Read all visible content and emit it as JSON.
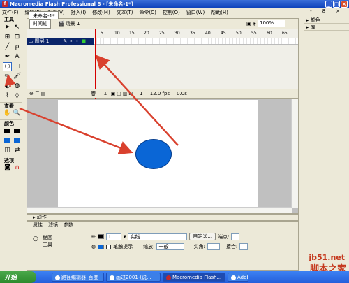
{
  "window": {
    "title": "Macromedia Flash Professional 8 - [未命名-1*]",
    "min": "_",
    "max": "□",
    "close": "×"
  },
  "menu": {
    "items": [
      "文件(F)",
      "编辑(E)",
      "视图(V)",
      "插入(I)",
      "修改(M)",
      "文本(T)",
      "命令(C)",
      "控制(O)",
      "窗口(W)",
      "帮助(H)"
    ],
    "right": [
      "-",
      "8",
      "×"
    ]
  },
  "tools": {
    "header": "工具",
    "section_view": "查看",
    "section_colors": "颜色",
    "section_options": "选项"
  },
  "doc": {
    "tab": "未命名-1*",
    "timeline_btn": "时间轴",
    "scene": "场景 1",
    "zoom": "100%"
  },
  "timeline": {
    "ruler": [
      "5",
      "10",
      "15",
      "20",
      "25",
      "30",
      "35",
      "40",
      "45",
      "50",
      "55",
      "60",
      "65"
    ],
    "layer_name": "图层 1",
    "frame": "1",
    "fps": "12.0 fps",
    "time": "0.0s"
  },
  "panels": {
    "actions": "动作",
    "tabs": [
      "属性",
      "滤镜",
      "参数"
    ],
    "tool_name_1": "椭圆",
    "tool_name_2": "工具",
    "stroke_height": "1",
    "stroke_style": "实线",
    "custom_btn": "自定义...",
    "endpoint_label": "端点:",
    "hint_label": "笔触提示",
    "scale_label": "缩放:",
    "scale_value": "一般",
    "corner_label": "尖角:",
    "join_label": "接合:"
  },
  "right_panels": [
    "颜色",
    "库"
  ],
  "taskbar": {
    "start": "开始",
    "tasks": [
      "路径编辑器_百度",
      "画过2001-(说...",
      "Macromedia Flash...",
      "Adobe"
    ]
  },
  "watermark": {
    "line1": "jb51.net",
    "line2": "脚本之家"
  },
  "colors": {
    "fill": "#0a66d6",
    "stroke": "#003a8c",
    "arrow": "#d9412e"
  }
}
